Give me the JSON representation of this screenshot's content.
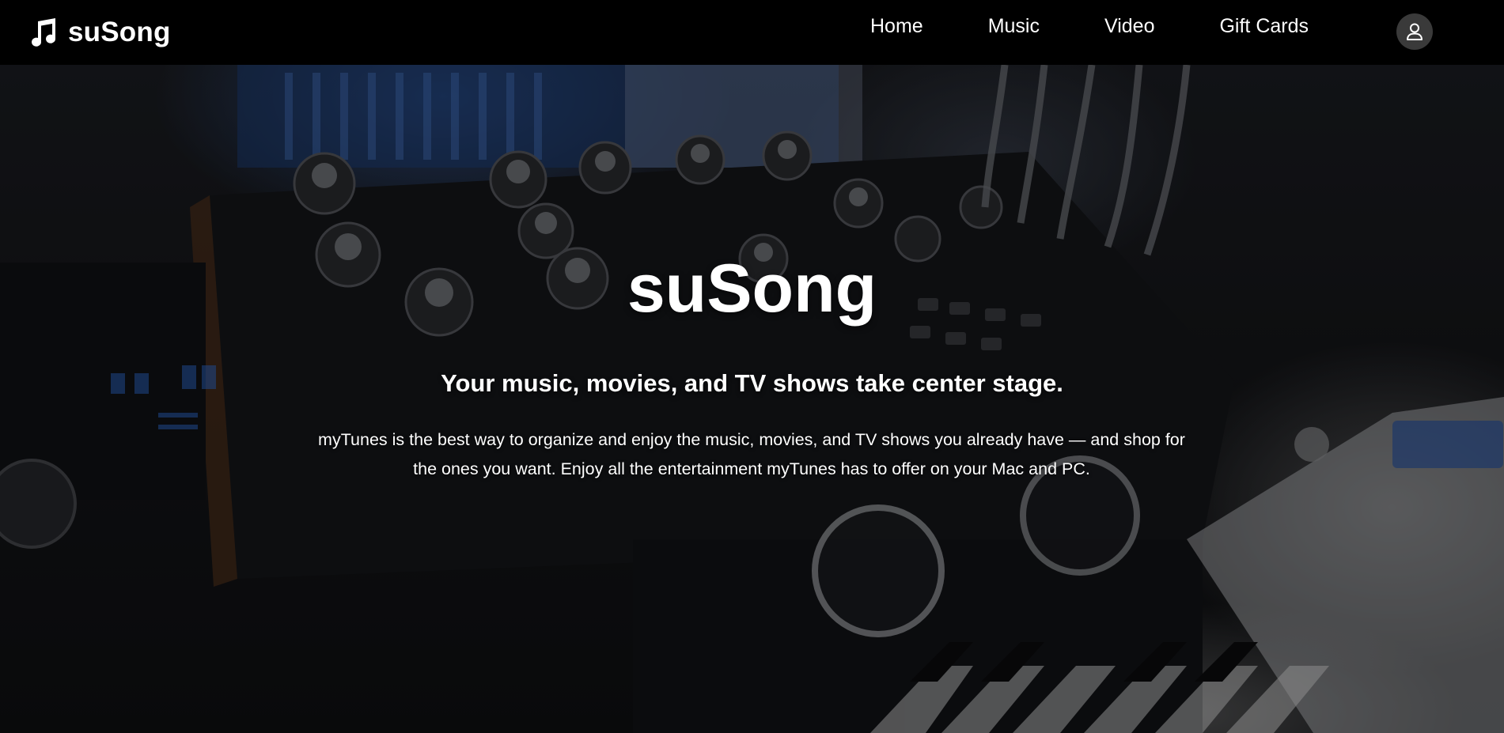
{
  "header": {
    "brand_name": "suSong",
    "brand_icon": "music-note-icon",
    "nav": [
      {
        "label": "Home"
      },
      {
        "label": "Music"
      },
      {
        "label": "Video"
      },
      {
        "label": "Gift Cards"
      }
    ],
    "account_icon": "user-icon"
  },
  "hero": {
    "title": "suSong",
    "subtitle": "Your music, movies, and TV shows take center stage.",
    "description": "myTunes is the best way to organize and enjoy the music, movies, and TV shows you already have — and shop for the ones you want. Enjoy all the entertainment myTunes has to offer on your Mac and PC.",
    "background_image": "synthesizer-background-image"
  },
  "colors": {
    "header_bg": "#000000",
    "text": "#ffffff",
    "account_bg": "#3a3a3a"
  }
}
